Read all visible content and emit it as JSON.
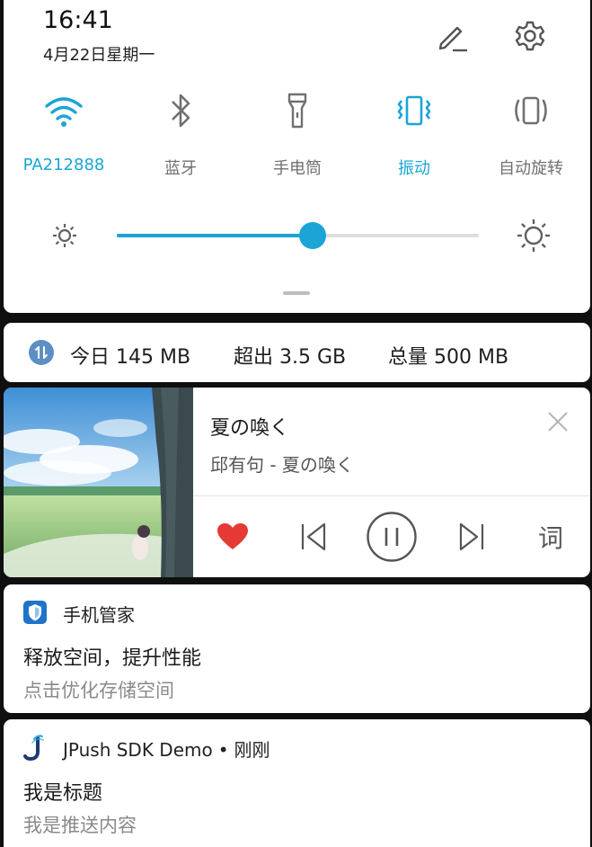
{
  "status": {
    "time": "16:41",
    "date": "4月22日星期一"
  },
  "header": {
    "edit_icon": "pencil-icon",
    "settings_icon": "gear-icon"
  },
  "quick_tiles": [
    {
      "id": "wifi",
      "label": "PA212888",
      "icon": "wifi-icon",
      "active": true
    },
    {
      "id": "bluetooth",
      "label": "蓝牙",
      "icon": "bluetooth-icon",
      "active": false
    },
    {
      "id": "flashlight",
      "label": "手电筒",
      "icon": "flashlight-icon",
      "active": false
    },
    {
      "id": "vibrate",
      "label": "振动",
      "icon": "vibrate-icon",
      "active": true
    },
    {
      "id": "autorotate",
      "label": "自动旋转",
      "icon": "rotate-icon",
      "active": false
    }
  ],
  "brightness": {
    "level": 0.54
  },
  "data_usage": {
    "today": "今日 145 MB",
    "exceeded": "超出 3.5 GB",
    "total": "总量 500 MB"
  },
  "music": {
    "title": "夏の喚く",
    "artist": "邱有句 - 夏の喚く",
    "lyrics_label": "词",
    "liked": true
  },
  "notifications": [
    {
      "app": "手机管家",
      "title": "释放空间，提升性能",
      "body": "点击优化存储空间"
    },
    {
      "app": "JPush SDK Demo",
      "time": "刚刚",
      "separator": "•",
      "title": "我是标题",
      "body": "我是推送内容"
    }
  ],
  "colors": {
    "accent": "#1aa5d6",
    "heart": "#e53935",
    "panel": "#ffffff",
    "background": "#0f0f10"
  }
}
